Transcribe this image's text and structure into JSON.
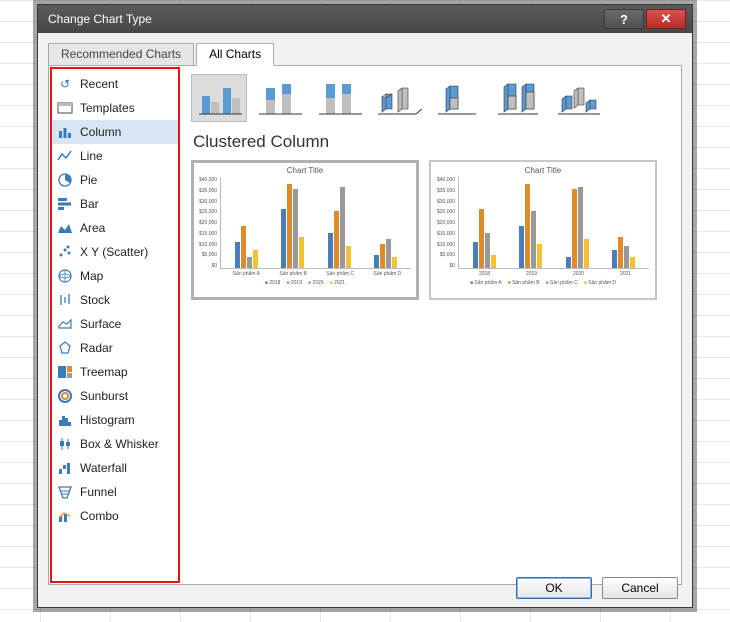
{
  "dialog": {
    "title": "Change Chart Type",
    "tabs": {
      "recommended": "Recommended Charts",
      "all": "All Charts"
    },
    "ok": "OK",
    "cancel": "Cancel"
  },
  "categories": [
    {
      "id": "recent",
      "label": "Recent"
    },
    {
      "id": "templates",
      "label": "Templates"
    },
    {
      "id": "column",
      "label": "Column",
      "selected": true
    },
    {
      "id": "line",
      "label": "Line"
    },
    {
      "id": "pie",
      "label": "Pie"
    },
    {
      "id": "bar",
      "label": "Bar"
    },
    {
      "id": "area",
      "label": "Area"
    },
    {
      "id": "scatter",
      "label": "X Y (Scatter)"
    },
    {
      "id": "map",
      "label": "Map"
    },
    {
      "id": "stock",
      "label": "Stock"
    },
    {
      "id": "surface",
      "label": "Surface"
    },
    {
      "id": "radar",
      "label": "Radar"
    },
    {
      "id": "treemap",
      "label": "Treemap"
    },
    {
      "id": "sunburst",
      "label": "Sunburst"
    },
    {
      "id": "histogram",
      "label": "Histogram"
    },
    {
      "id": "boxwhisker",
      "label": "Box & Whisker"
    },
    {
      "id": "waterfall",
      "label": "Waterfall"
    },
    {
      "id": "funnel",
      "label": "Funnel"
    },
    {
      "id": "combo",
      "label": "Combo"
    }
  ],
  "selected_chart_name": "Clustered Column",
  "preview1": {
    "title": "Chart Title",
    "yticks": [
      "$40,000",
      "$35,000",
      "$30,000",
      "$25,000",
      "$20,000",
      "$15,000",
      "$10,000",
      "$5,000",
      "$0"
    ],
    "xticks": [
      "Sản phẩm A",
      "Sản phẩm B",
      "Sản phẩm C",
      "Sản phẩm D"
    ],
    "legend": [
      "2018",
      "2019",
      "2020",
      "2021"
    ]
  },
  "preview2": {
    "title": "Chart Title",
    "yticks": [
      "$40,000",
      "$35,000",
      "$30,000",
      "$25,000",
      "$20,000",
      "$15,000",
      "$10,000",
      "$5,000",
      "$0"
    ],
    "xticks": [
      "2018",
      "2019",
      "2020",
      "2021"
    ],
    "legend": [
      "Sản phẩm A",
      "Sản phẩm B",
      "Sản phẩm C",
      "Sản phẩm D"
    ]
  },
  "chart_data": [
    {
      "type": "bar",
      "title": "Chart Title",
      "categories": [
        "Sản phẩm A",
        "Sản phẩm B",
        "Sản phẩm C",
        "Sản phẩm D"
      ],
      "series": [
        {
          "name": "2018",
          "values": [
            12000,
            27000,
            16000,
            6000
          ]
        },
        {
          "name": "2019",
          "values": [
            19000,
            38000,
            26000,
            11000
          ]
        },
        {
          "name": "2020",
          "values": [
            5000,
            36000,
            37000,
            13000
          ]
        },
        {
          "name": "2021",
          "values": [
            8000,
            14000,
            10000,
            5000
          ]
        }
      ],
      "ylabel": "",
      "xlabel": "",
      "ylim": [
        0,
        40000
      ]
    },
    {
      "type": "bar",
      "title": "Chart Title",
      "categories": [
        "2018",
        "2019",
        "2020",
        "2021"
      ],
      "series": [
        {
          "name": "Sản phẩm A",
          "values": [
            12000,
            19000,
            5000,
            8000
          ]
        },
        {
          "name": "Sản phẩm B",
          "values": [
            27000,
            38000,
            36000,
            14000
          ]
        },
        {
          "name": "Sản phẩm C",
          "values": [
            16000,
            26000,
            37000,
            10000
          ]
        },
        {
          "name": "Sản phẩm D",
          "values": [
            6000,
            11000,
            13000,
            5000
          ]
        }
      ],
      "ylabel": "",
      "xlabel": "",
      "ylim": [
        0,
        40000
      ]
    }
  ]
}
